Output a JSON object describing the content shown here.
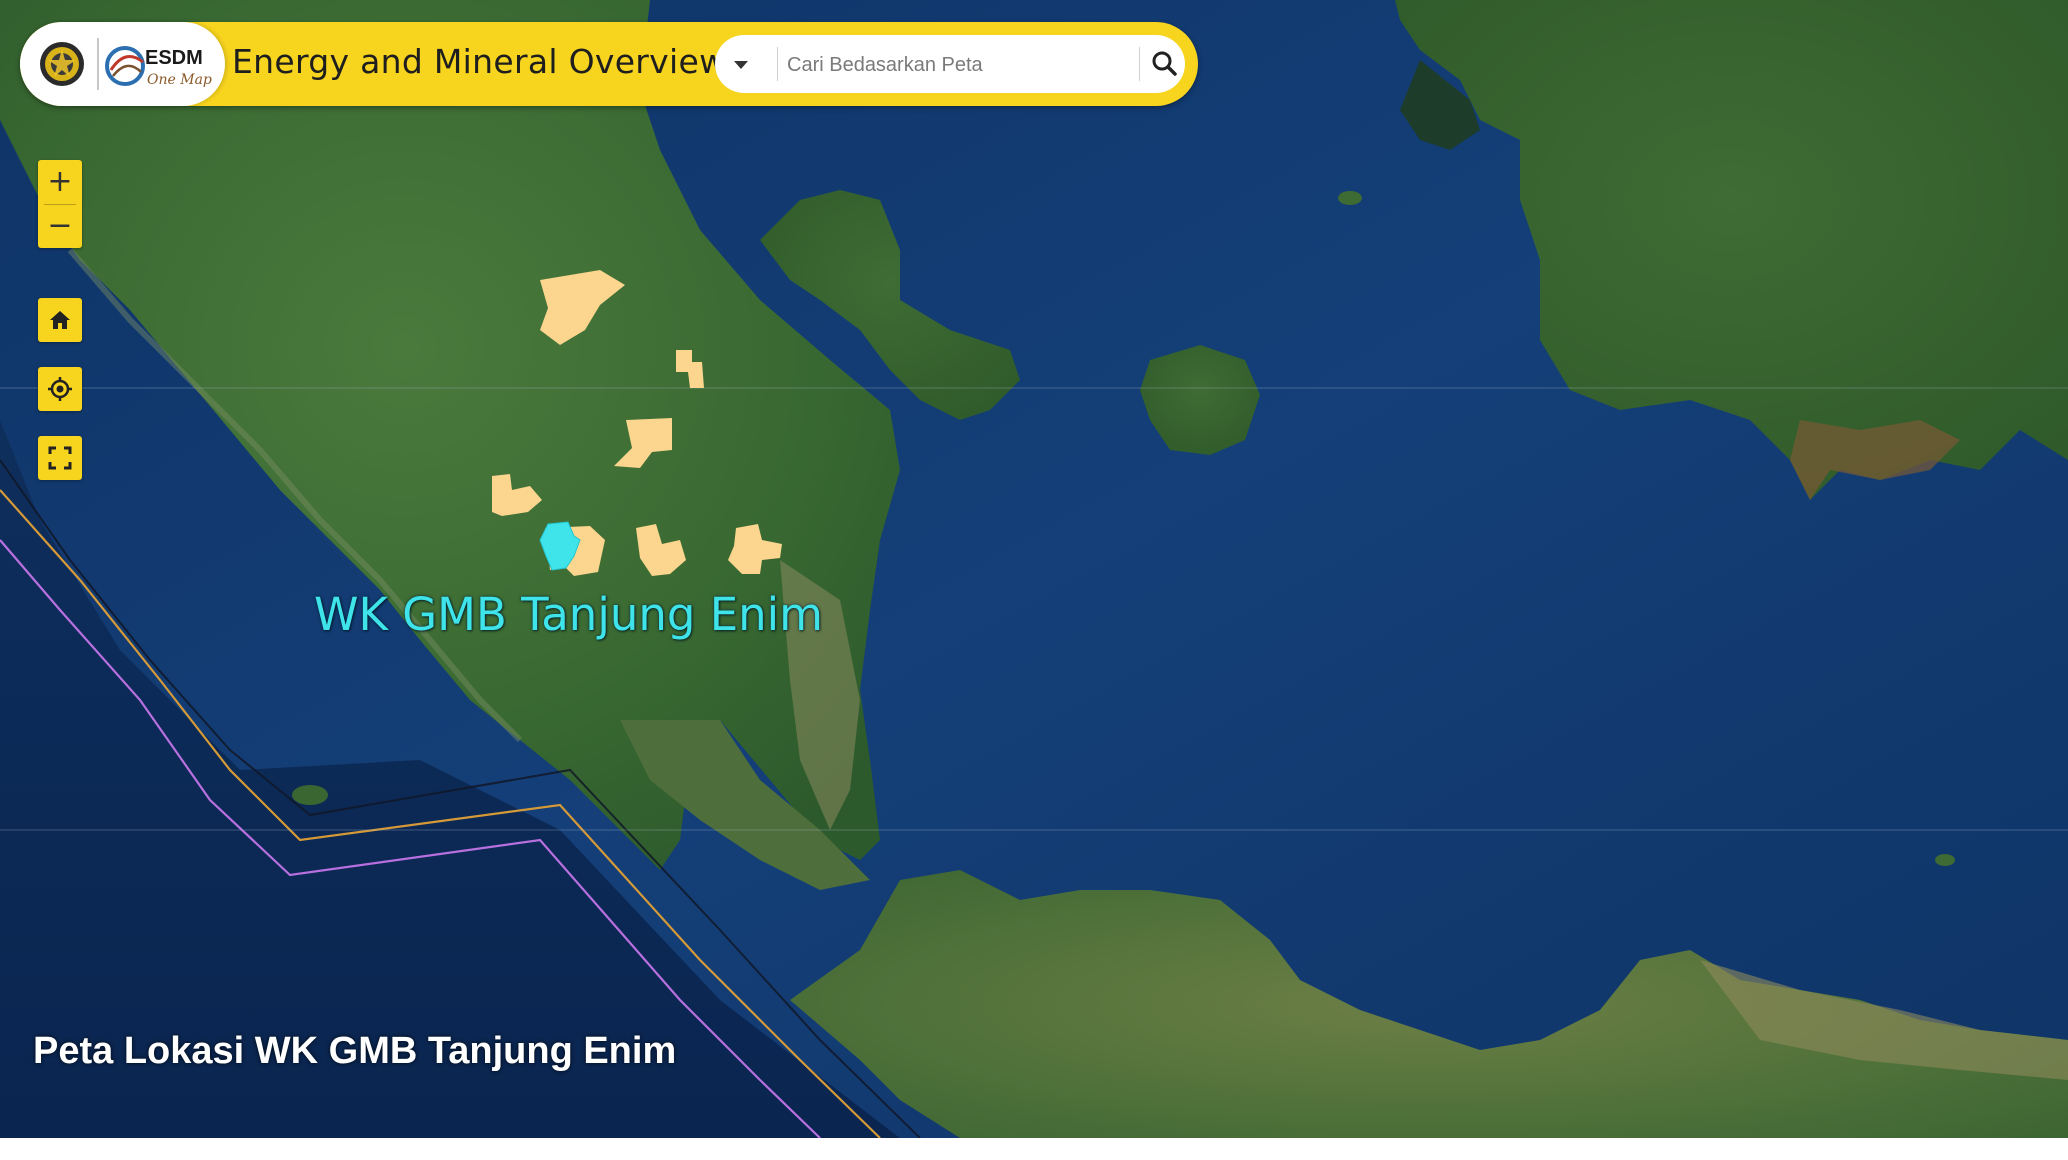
{
  "header": {
    "logo_text": "ESDM",
    "logo_subtext": "One Map",
    "app_title": "Energy and Mineral Overview",
    "search": {
      "placeholder": "Cari Bedasarkan Peta",
      "value": ""
    }
  },
  "map_controls": {
    "zoom_in_label": "+",
    "zoom_out_label": "−",
    "home_icon": "home-icon",
    "locate_icon": "locate-icon",
    "fullscreen_icon": "fullscreen-icon"
  },
  "map": {
    "basemap": "satellite imagery",
    "highlighted_area_label": "WK GMB Tanjung Enim",
    "caption": "Peta Lokasi WK GMB Tanjung Enim"
  },
  "colors": {
    "toolbar": "#f7d41e",
    "mining_areas": "#fcd58e",
    "highlight": "#3fe3ea",
    "ocean": "#123a70",
    "land": "#3b6a33"
  }
}
